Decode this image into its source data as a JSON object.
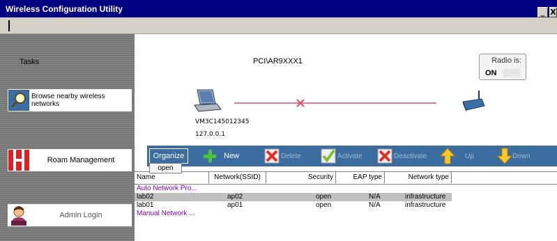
{
  "window": {
    "title": "Wireless Configuration Utility",
    "minimize": "_",
    "close": "X"
  },
  "sidebar": {
    "tasks_label": "Tasks",
    "browse_label": "Browse nearby wireless networks",
    "roam_label": "Roam Management",
    "admin_label": "Admin Login"
  },
  "network": {
    "adapter": "PCI\\AR9XXX1",
    "hostname": "VM3C145012345",
    "ip": "127.0.0.1",
    "radio_label": "Radio is:",
    "radio_on": "ON",
    "radio_off": "OFF"
  },
  "toolbar": {
    "organize": "Organize",
    "new": "New",
    "delete": "Delete",
    "activate": "Activate",
    "deactivate": "Deactivate",
    "up": "Up",
    "down": "Down"
  },
  "popup": {
    "open": "open"
  },
  "table": {
    "headers": [
      "Name",
      "Network(SSID)",
      "Security",
      "EAP type",
      "Network type"
    ],
    "auto_group": "Auto Network Pro...",
    "manual_group": "Manual Network ...",
    "rows": [
      {
        "name": "lab02",
        "ssid": "ap02",
        "security": "open",
        "eap": "N/A",
        "type": "infrastructure"
      },
      {
        "name": "lab01",
        "ssid": "ap01",
        "security": "open",
        "eap": "N/A",
        "type": "infrastructure"
      }
    ]
  },
  "colors": {
    "titlebar": "#000080",
    "toolbar": "#3b6da0",
    "group_text": "#8000c0",
    "link_x": "#e0506a"
  }
}
